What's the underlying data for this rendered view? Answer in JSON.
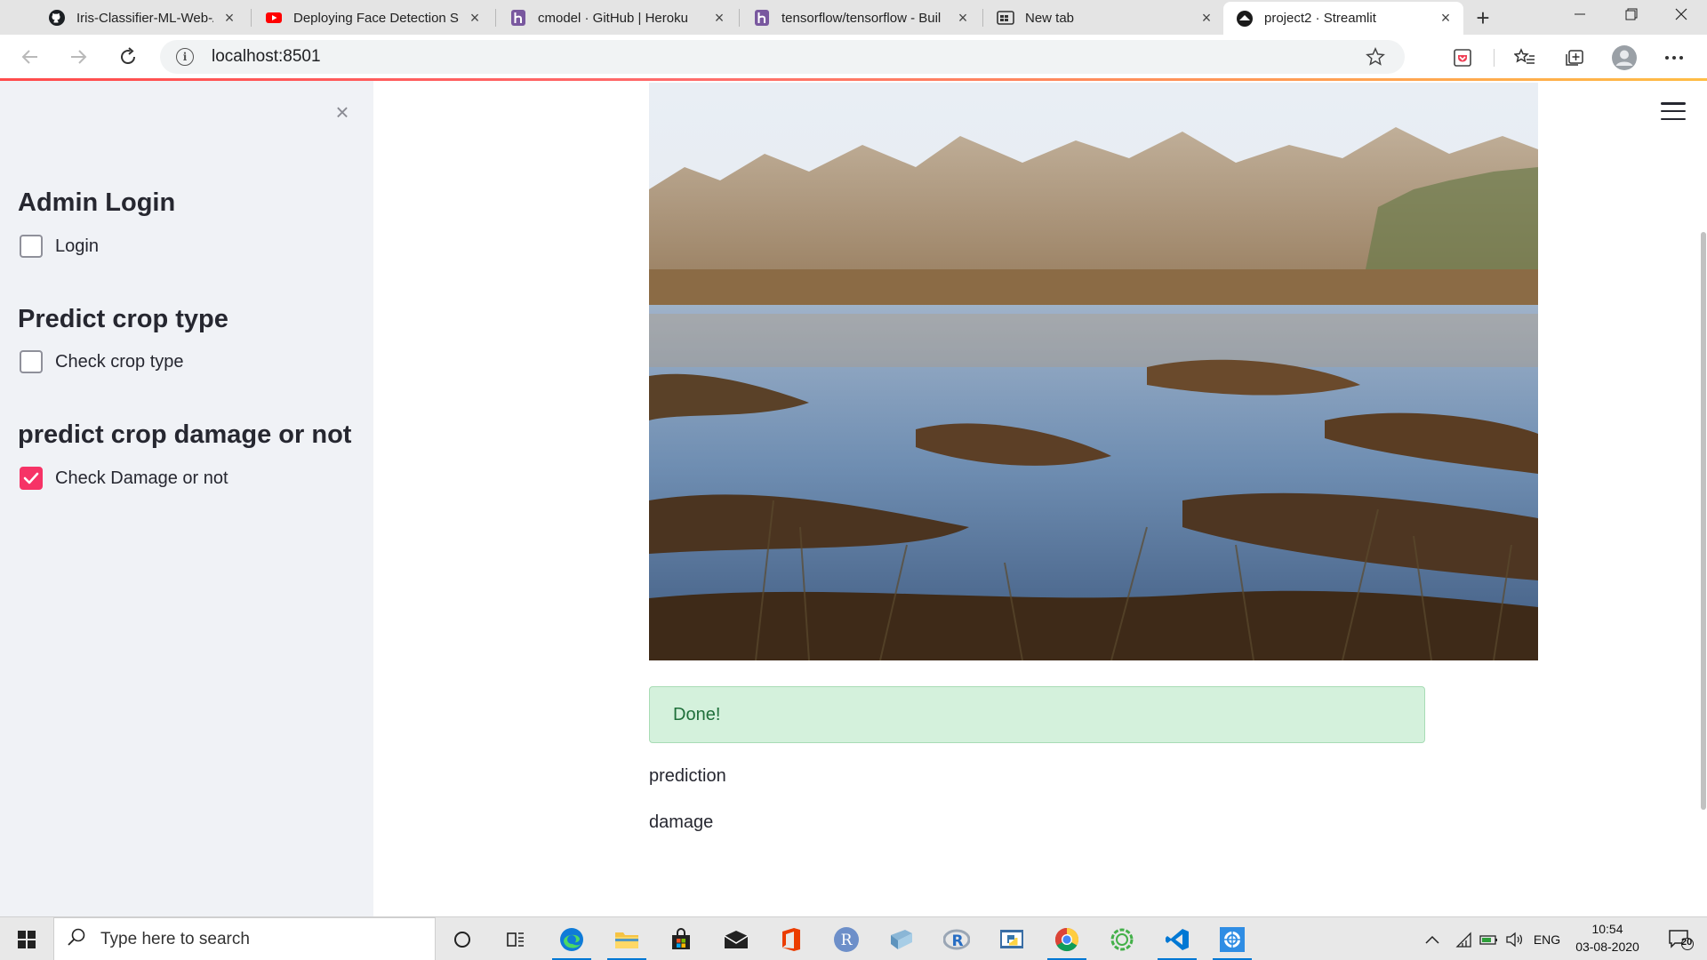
{
  "browser": {
    "tabs": [
      {
        "title": "Iris-Classifier-ML-Web-App/c",
        "icon": "github-icon"
      },
      {
        "title": "Deploying Face Detection St",
        "icon": "youtube-icon"
      },
      {
        "title": "cmodel · GitHub | Heroku",
        "icon": "heroku-icon"
      },
      {
        "title": "tensorflow/tensorflow - Buil",
        "icon": "heroku-icon"
      },
      {
        "title": "New tab",
        "icon": "new-tab-page-icon"
      },
      {
        "title": "project2 · Streamlit",
        "icon": "streamlit-icon",
        "active": true
      }
    ],
    "url": "localhost:8501"
  },
  "sidebar": {
    "sections": [
      {
        "heading": "Admin Login",
        "checkbox_label": "Login",
        "checked": false
      },
      {
        "heading": "Predict crop type",
        "checkbox_label": "Check crop type",
        "checked": false
      },
      {
        "heading": "predict crop damage or not",
        "checkbox_label": "Check Damage or not",
        "checked": true
      }
    ],
    "accent_color": "#f63366"
  },
  "main": {
    "image_subject": "flooded field with wetland, bare trees and reflections in water",
    "success_message": "Done!",
    "prediction_label": "prediction",
    "prediction_value": "damage"
  },
  "taskbar": {
    "search_placeholder": "Type here to search",
    "language": "ENG",
    "time": "10:54",
    "date": "03-08-2020",
    "notifications": "20"
  }
}
